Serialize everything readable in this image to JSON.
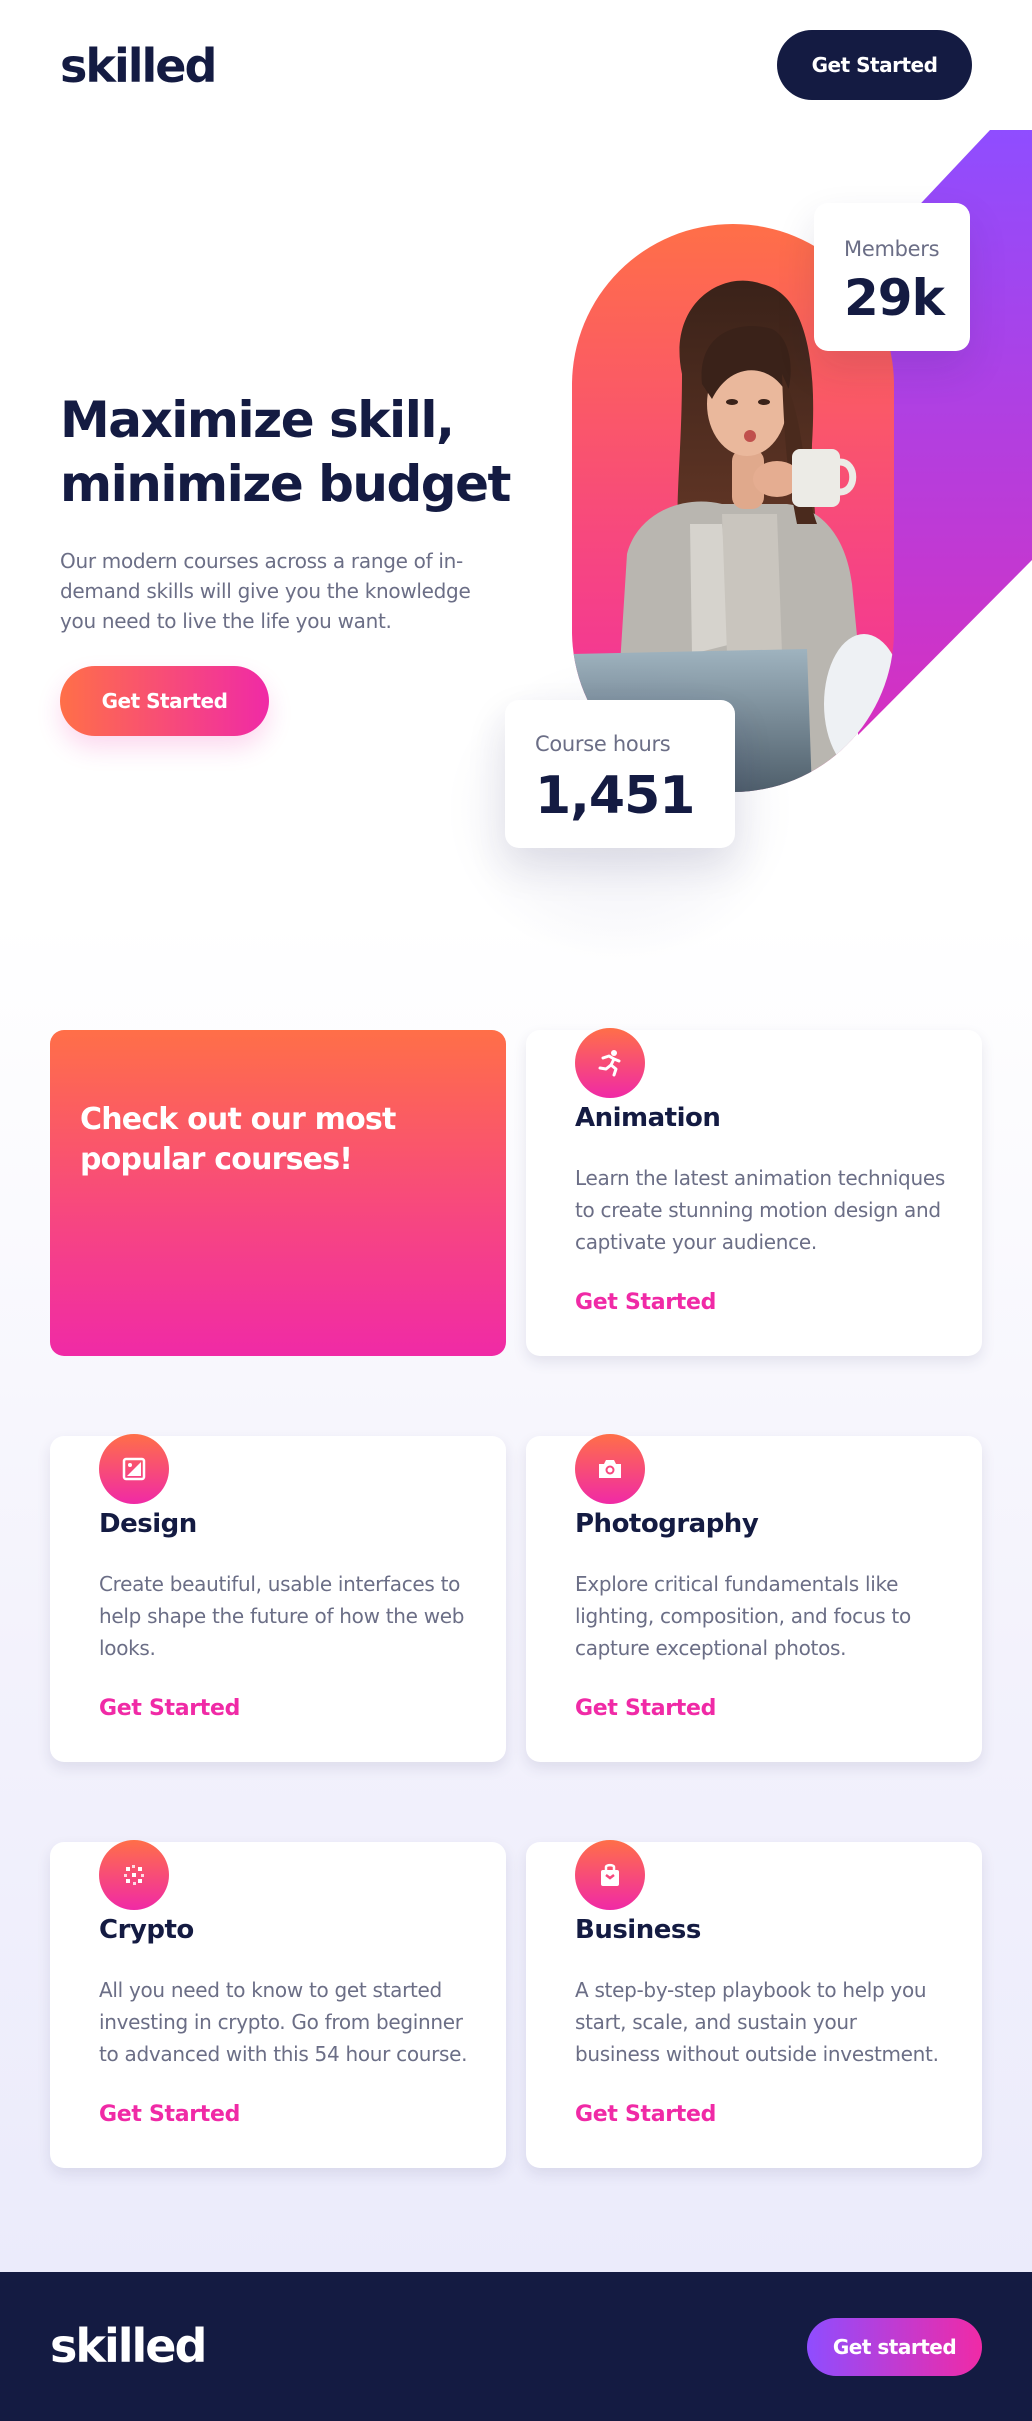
{
  "header": {
    "logo": "skilled",
    "cta_label": "Get Started"
  },
  "hero": {
    "title": "Maximize skill, minimize budget",
    "description": "Our modern courses across a range of in-demand skills will give you the knowledge you need to live the life you want.",
    "cta_label": "Get Started",
    "stats": {
      "members_label": "Members",
      "members_value": "29k",
      "hours_label": "Course hours",
      "hours_value": "1,451"
    }
  },
  "courses": {
    "promo_title": "Check out our most popular courses!",
    "items": [
      {
        "icon": "animation-icon",
        "title": "Animation",
        "description": "Learn the latest animation techniques to create stunning motion design and captivate your audience.",
        "link": "Get Started"
      },
      {
        "icon": "design-icon",
        "title": "Design",
        "description": "Create beautiful, usable interfaces to help shape the future of how the web looks.",
        "link": "Get Started"
      },
      {
        "icon": "camera-icon",
        "title": "Photography",
        "description": "Explore critical fundamentals like lighting, composition, and focus to capture exceptional photos.",
        "link": "Get Started"
      },
      {
        "icon": "crypto-icon",
        "title": "Crypto",
        "description": "All you need to know to get started investing in crypto. Go from beginner to advanced with this 54 hour course.",
        "link": "Get Started"
      },
      {
        "icon": "business-icon",
        "title": "Business",
        "description": "A step-by-step playbook to help you start, scale, and sustain your business without outside investment.",
        "link": "Get Started"
      }
    ]
  },
  "footer": {
    "logo": "skilled",
    "cta_label": "Get started"
  },
  "colors": {
    "navy": "#141b42",
    "gradient_start": "#ff6f48",
    "gradient_end": "#f02aa6",
    "purple": "#8f4dff",
    "muted_text": "#6b6e86"
  }
}
